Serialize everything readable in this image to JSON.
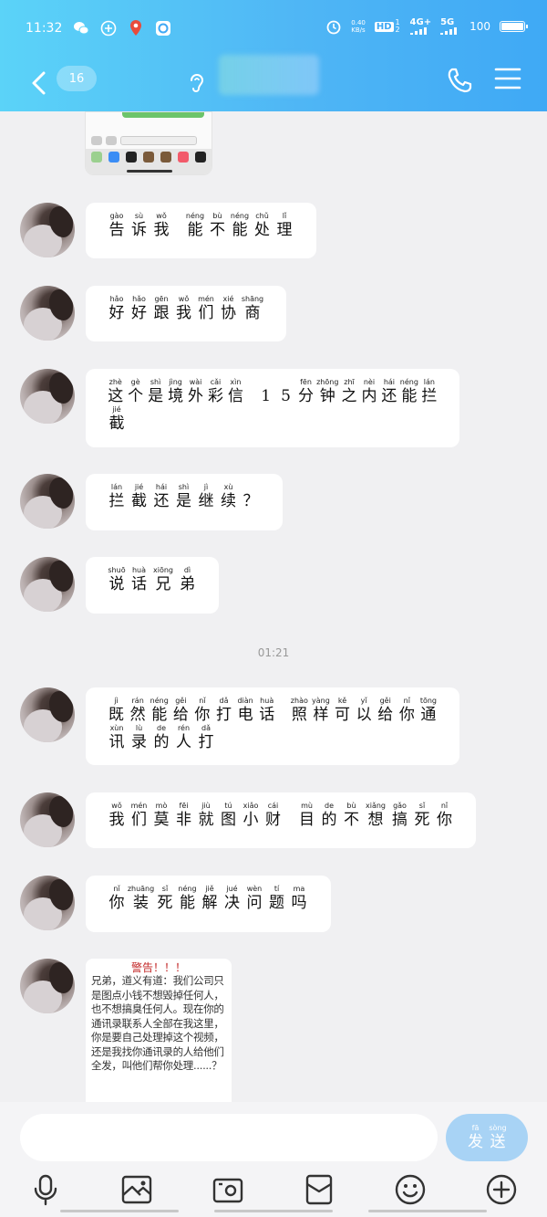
{
  "status_bar": {
    "time": "11:32",
    "net_speed_top": "0.40",
    "net_speed_bottom": "KB/s",
    "hd_label": "HD",
    "hd_sub": "1 2",
    "network_1": "4G+",
    "network_2": "5G",
    "battery": "100"
  },
  "nav": {
    "unread_count": "16"
  },
  "messages": [
    {
      "id": "m1",
      "lines": [
        [
          [
            "gào",
            "告"
          ],
          [
            "sù",
            "诉"
          ],
          [
            "wǒ",
            "我"
          ],
          [
            "",
            ""
          ],
          [
            "néng",
            "能"
          ],
          [
            "bù",
            "不"
          ],
          [
            "néng",
            "能"
          ],
          [
            "chǔ",
            "处"
          ],
          [
            "lǐ",
            "理"
          ]
        ]
      ]
    },
    {
      "id": "m2",
      "lines": [
        [
          [
            "hǎo",
            "好"
          ],
          [
            "hǎo",
            "好"
          ],
          [
            "gēn",
            "跟"
          ],
          [
            "wǒ",
            "我"
          ],
          [
            "mén",
            "们"
          ],
          [
            "xié",
            "协"
          ],
          [
            "shāng",
            "商"
          ]
        ]
      ]
    },
    {
      "id": "m3",
      "lines": [
        [
          [
            "zhè",
            "这"
          ],
          [
            "gè",
            "个"
          ],
          [
            "shì",
            "是"
          ],
          [
            "jìng",
            "境"
          ],
          [
            "wài",
            "外"
          ],
          [
            "cǎi",
            "彩"
          ],
          [
            "xìn",
            "信"
          ],
          [
            "",
            ""
          ],
          [
            "",
            "1"
          ],
          [
            "",
            "5"
          ],
          [
            "fēn",
            "分"
          ],
          [
            "zhōng",
            "钟"
          ],
          [
            "zhī",
            "之"
          ],
          [
            "nèi",
            "内"
          ],
          [
            "hái",
            "还"
          ],
          [
            "néng",
            "能"
          ],
          [
            "lán",
            "拦"
          ]
        ],
        [
          [
            "jié",
            "截"
          ]
        ]
      ]
    },
    {
      "id": "m4",
      "lines": [
        [
          [
            "lán",
            "拦"
          ],
          [
            "jié",
            "截"
          ],
          [
            "hái",
            "还"
          ],
          [
            "shì",
            "是"
          ],
          [
            "jì",
            "继"
          ],
          [
            "xù",
            "续"
          ],
          [
            "",
            "？"
          ]
        ]
      ]
    },
    {
      "id": "m5",
      "lines": [
        [
          [
            "shuō",
            "说"
          ],
          [
            "huà",
            "话"
          ],
          [
            "xiōng",
            "兄"
          ],
          [
            "dì",
            "弟"
          ]
        ]
      ]
    },
    {
      "id": "m6",
      "lines": [
        [
          [
            "jì",
            "既"
          ],
          [
            "rán",
            "然"
          ],
          [
            "néng",
            "能"
          ],
          [
            "gěi",
            "给"
          ],
          [
            "nǐ",
            "你"
          ],
          [
            "dǎ",
            "打"
          ],
          [
            "diàn",
            "电"
          ],
          [
            "huà",
            "话"
          ],
          [
            "",
            ""
          ],
          [
            "zhào",
            "照"
          ],
          [
            "yàng",
            "样"
          ],
          [
            "kě",
            "可"
          ],
          [
            "yǐ",
            "以"
          ],
          [
            "gěi",
            "给"
          ],
          [
            "nǐ",
            "你"
          ],
          [
            "tōng",
            "通"
          ]
        ],
        [
          [
            "xùn",
            "讯"
          ],
          [
            "lù",
            "录"
          ],
          [
            "de",
            "的"
          ],
          [
            "rén",
            "人"
          ],
          [
            "dǎ",
            "打"
          ]
        ]
      ]
    },
    {
      "id": "m7",
      "lines": [
        [
          [
            "wǒ",
            "我"
          ],
          [
            "mén",
            "们"
          ],
          [
            "mò",
            "莫"
          ],
          [
            "fēi",
            "非"
          ],
          [
            "jiù",
            "就"
          ],
          [
            "tú",
            "图"
          ],
          [
            "xiǎo",
            "小"
          ],
          [
            "cái",
            "财"
          ],
          [
            "",
            ""
          ],
          [
            "mù",
            "目"
          ],
          [
            "de",
            "的"
          ],
          [
            "bù",
            "不"
          ],
          [
            "xiǎng",
            "想"
          ],
          [
            "gǎo",
            "搞"
          ],
          [
            "sǐ",
            "死"
          ],
          [
            "nǐ",
            "你"
          ]
        ]
      ]
    },
    {
      "id": "m8",
      "lines": [
        [
          [
            "nǐ",
            "你"
          ],
          [
            "zhuāng",
            "装"
          ],
          [
            "sǐ",
            "死"
          ],
          [
            "néng",
            "能"
          ],
          [
            "jiě",
            "解"
          ],
          [
            "jué",
            "决"
          ],
          [
            "wèn",
            "问"
          ],
          [
            "tí",
            "题"
          ],
          [
            "ma",
            "吗"
          ]
        ]
      ]
    }
  ],
  "timestamp": "01:21",
  "image_message": {
    "title": "警告！！！",
    "body": "兄弟，道义有道：我们公司只是图点小钱不想毁掉任何人，也不想搞臭任何人。现在你的通讯录联系人全部在我这里，你是要自己处理掉这个视频，还是我找你通讯录的人给他们全发，叫他们帮你处理......？"
  },
  "input": {
    "value": "",
    "send_label": [
      [
        "fā",
        "发"
      ],
      [
        "sòng",
        "送"
      ]
    ]
  },
  "icons": {
    "back": "chevron-left-icon",
    "ear": "ear-icon",
    "phone": "phone-icon",
    "menu": "menu-icon",
    "mic": "microphone-icon",
    "gallery": "gallery-icon",
    "camera": "camera-icon",
    "redpacket": "red-packet-icon",
    "emoji": "emoji-icon",
    "plus": "plus-icon"
  },
  "colors": {
    "header_gradient_start": "#5bd3f8",
    "header_gradient_end": "#3fa9f5",
    "send_button": "#a8d3f5",
    "chat_bg": "#f0f0f2",
    "warning_red": "#c32a2a"
  }
}
